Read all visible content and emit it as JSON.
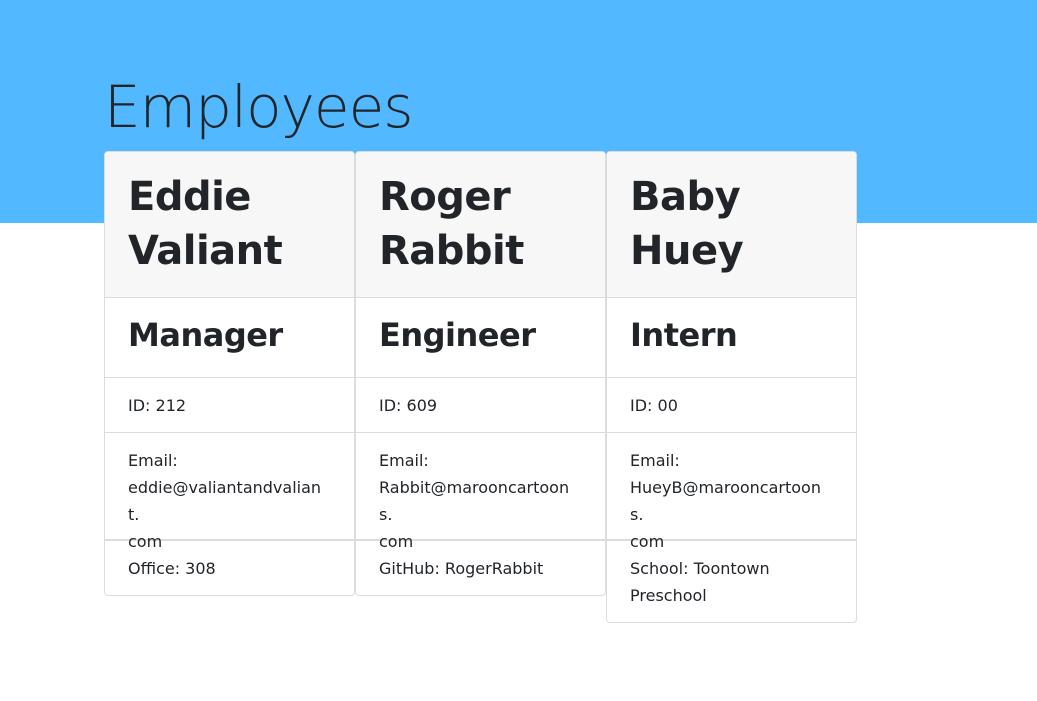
{
  "page": {
    "title": "Employees"
  },
  "employees": [
    {
      "name_line1": "Eddie",
      "name_line2": "Valiant",
      "role": "Manager",
      "id_label": "ID: 212",
      "email_label": "Email:",
      "email_line1": "eddie@valiantandvaliant.",
      "email_line2": "com",
      "extra_label": "Office: 308"
    },
    {
      "name_line1": "Roger",
      "name_line2": "Rabbit",
      "role": "Engineer",
      "id_label": "ID: 609",
      "email_label": "Email:",
      "email_line1": "Rabbit@marooncartoons.",
      "email_line2": "com",
      "extra_label": "GitHub: RogerRabbit"
    },
    {
      "name_line1": "Baby",
      "name_line2": "Huey",
      "role": "Intern",
      "id_label": "ID: 00",
      "email_label": "Email:",
      "email_line1": "HueyB@marooncartoons.",
      "email_line2": "com",
      "extra_label": "School: Toontown Preschool"
    }
  ],
  "colors": {
    "banner": "#52b8ff",
    "card_header": "#f7f7f7",
    "text": "#212529",
    "border": "#dcdcdc"
  }
}
